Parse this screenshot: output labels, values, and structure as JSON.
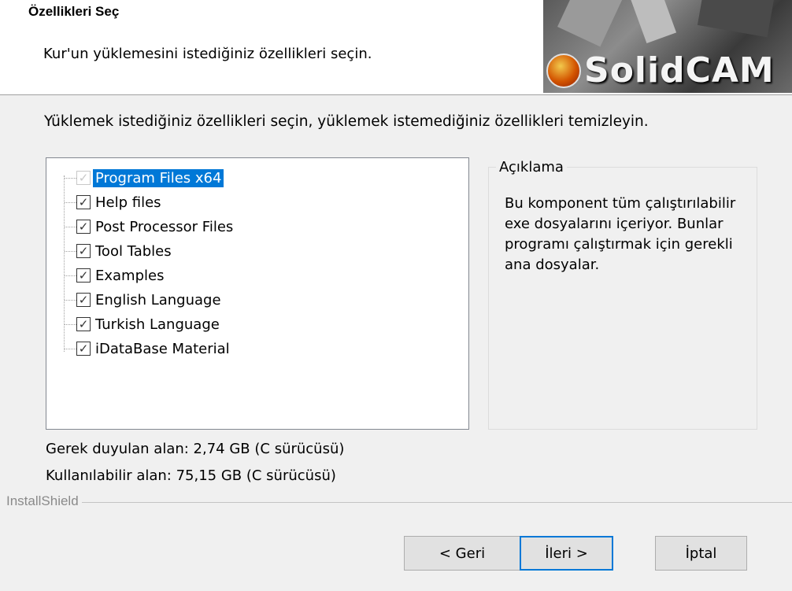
{
  "header": {
    "title": "Özellikleri Seç",
    "subtitle": "Kur'un yüklemesini istediğiniz özellikleri seçin.",
    "logo_text": "SolidCAM"
  },
  "instruction": "Yüklemek istediğiniz özellikleri seçin, yüklemek istemediğiniz özellikleri temizleyin.",
  "tree": {
    "items": [
      {
        "label": "Program Files x64",
        "checked": true,
        "disabled": true,
        "selected": true
      },
      {
        "label": "Help files",
        "checked": true,
        "disabled": false,
        "selected": false
      },
      {
        "label": "Post Processor Files",
        "checked": true,
        "disabled": false,
        "selected": false
      },
      {
        "label": "Tool Tables",
        "checked": true,
        "disabled": false,
        "selected": false
      },
      {
        "label": "Examples",
        "checked": true,
        "disabled": false,
        "selected": false
      },
      {
        "label": "English Language",
        "checked": true,
        "disabled": false,
        "selected": false
      },
      {
        "label": "Turkish Language",
        "checked": true,
        "disabled": false,
        "selected": false
      },
      {
        "label": "iDataBase Material",
        "checked": true,
        "disabled": false,
        "selected": false
      }
    ]
  },
  "description": {
    "legend": "Açıklama",
    "text": "Bu komponent tüm çalıştırılabilir exe dosyalarını içeriyor. Bunlar programı çalıştırmak için gerekli ana dosyalar."
  },
  "space": {
    "required": "Gerek duyulan alan: 2,74 GB (C sürücüsü)",
    "available": "Kullanılabilir alan: 75,15 GB (C sürücüsü)"
  },
  "footer": {
    "brand": "InstallShield",
    "back_label": "< Geri",
    "next_label": "İleri >",
    "cancel_label": "İptal"
  },
  "colors": {
    "selection": "#0078d7",
    "default_button_border": "#0078d7"
  }
}
